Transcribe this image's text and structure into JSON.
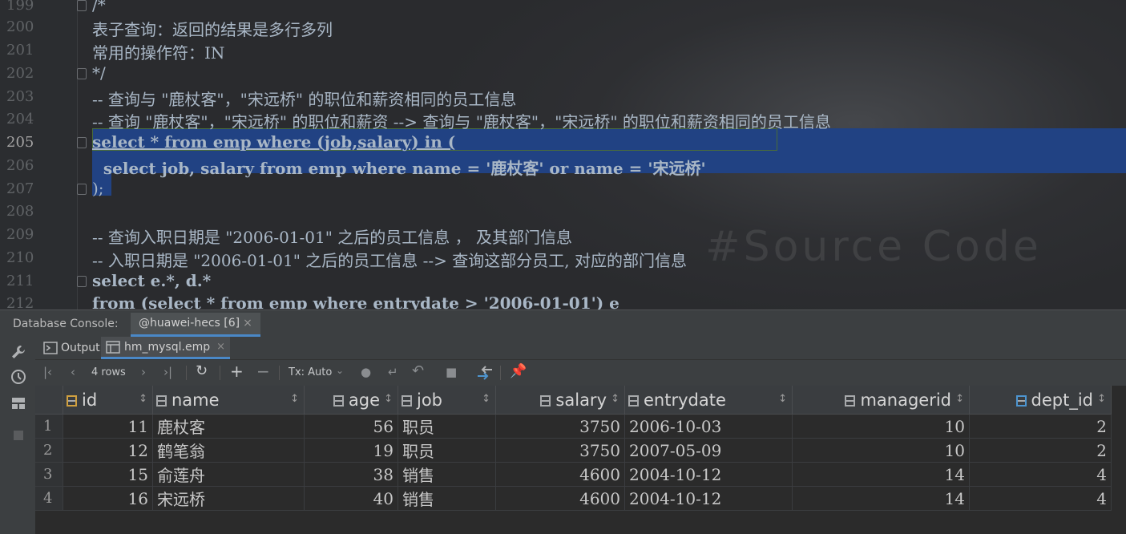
{
  "editor": {
    "lines": [
      {
        "n": "199",
        "code": "/*"
      },
      {
        "n": "200",
        "code": "表子查询：返回的结果是多行多列"
      },
      {
        "n": "201",
        "code": "常用的操作符：IN"
      },
      {
        "n": "202",
        "code": "*/"
      },
      {
        "n": "203",
        "code": "-- 查询与 \"鹿杖客\"，\"宋远桥\" 的职位和薪资相同的员工信息"
      },
      {
        "n": "204",
        "code": "-- 查询 \"鹿杖客\"，\"宋远桥\" 的职位和薪资 --> 查询与 \"鹿杖客\"，\"宋远桥\" 的职位和薪资相同的员工信息"
      },
      {
        "n": "205",
        "code": "select * from emp where (job,salary) in ("
      },
      {
        "n": "206",
        "code": "  select job, salary from emp where name = '鹿杖客' or name = '宋远桥'"
      },
      {
        "n": "207",
        "code": ");"
      },
      {
        "n": "208",
        "code": ""
      },
      {
        "n": "209",
        "code": "-- 查询入职日期是 \"2006-01-01\" 之后的员工信息 ， 及其部门信息"
      },
      {
        "n": "210",
        "code": "-- 入职日期是 \"2006-01-01\" 之后的员工信息 --> 查询这部分员工, 对应的部门信息"
      },
      {
        "n": "211",
        "code": "select e.*, d.*"
      },
      {
        "n": "212",
        "code": "from (select * from emp where entrydate > '2006-01-01') e"
      }
    ],
    "background_text": "#Source Code"
  },
  "console": {
    "title": "Database Console:",
    "session_tab": "@huawei-hecs [6]",
    "close_symbol": "×"
  },
  "subtabs": {
    "output": "Output",
    "result": "hm_mysql.emp",
    "close_symbol": "×"
  },
  "toolbar": {
    "rows": "4 rows",
    "tx": "Tx: Auto"
  },
  "grid": {
    "columns": [
      "id",
      "name",
      "age",
      "job",
      "salary",
      "entrydate",
      "managerid",
      "dept_id"
    ],
    "rows": [
      {
        "rn": "1",
        "id": "11",
        "name": "鹿杖客",
        "age": "56",
        "job": "职员",
        "salary": "3750",
        "entrydate": "2006-10-03",
        "managerid": "10",
        "dept_id": "2"
      },
      {
        "rn": "2",
        "id": "12",
        "name": "鹤笔翁",
        "age": "19",
        "job": "职员",
        "salary": "3750",
        "entrydate": "2007-05-09",
        "managerid": "10",
        "dept_id": "2"
      },
      {
        "rn": "3",
        "id": "15",
        "name": "俞莲舟",
        "age": "38",
        "job": "销售",
        "salary": "4600",
        "entrydate": "2004-10-12",
        "managerid": "14",
        "dept_id": "4"
      },
      {
        "rn": "4",
        "id": "16",
        "name": "宋远桥",
        "age": "40",
        "job": "销售",
        "salary": "4600",
        "entrydate": "2004-10-12",
        "managerid": "14",
        "dept_id": "4"
      }
    ]
  },
  "colors": {
    "selection": "#214283",
    "keyword": "#cc7832",
    "string": "#6a8759",
    "comment": "#808080"
  }
}
